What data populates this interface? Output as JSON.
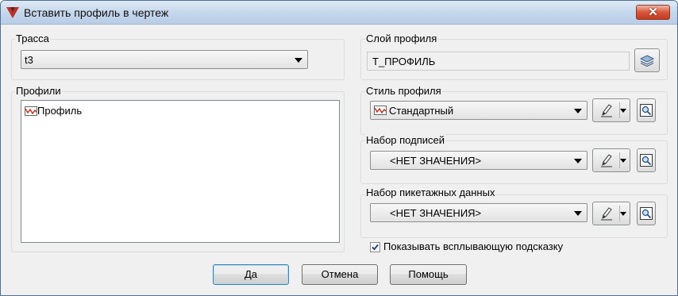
{
  "window": {
    "title": "Вставить профиль в чертеж",
    "close_glyph": "✕"
  },
  "alignment": {
    "label": "Трасса",
    "value": "t3"
  },
  "profiles": {
    "label": "Профили",
    "items": [
      {
        "icon": "profile-icon",
        "label": "Профиль"
      }
    ]
  },
  "profile_layer": {
    "label": "Слой профиля",
    "value": "Т_ПРОФИЛЬ",
    "button_icon": "layers-icon"
  },
  "profile_style": {
    "label": "Стиль профиля",
    "value": "Стандартный",
    "value_icon": "profile-style-icon"
  },
  "label_set": {
    "label": "Набор подписей",
    "value": "<НЕТ ЗНАЧЕНИЯ>"
  },
  "band_set": {
    "label": "Набор пикетажных данных",
    "value": "<НЕТ ЗНАЧЕНИЯ>"
  },
  "tooltip_option": {
    "label": "Показывать всплывающую подсказку",
    "checked": true
  },
  "buttons": {
    "ok": "Да",
    "cancel": "Отмена",
    "help": "Помощь"
  },
  "colors": {
    "title_bar": "#c4d6ec",
    "close_button": "#c43a1e",
    "dialog_background": "#f0f0f0",
    "default_button_border": "#3c7fb1"
  }
}
